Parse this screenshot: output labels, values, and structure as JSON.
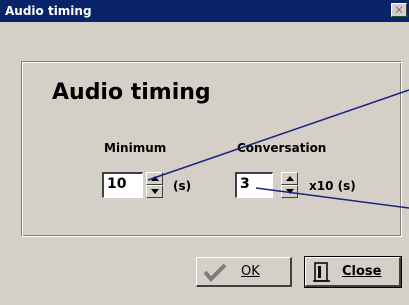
{
  "window": {
    "title": "Audio timing",
    "close_glyph": "✕"
  },
  "main": {
    "heading": "Audio timing",
    "minimum": {
      "label": "Minimum",
      "value": "10",
      "unit": "(s)"
    },
    "conversation": {
      "label": "Conversation",
      "value": "3",
      "unit": "x10 (s)"
    }
  },
  "buttons": {
    "ok_label": "OK",
    "close_label": "Close"
  },
  "colors": {
    "title_bar": "#0a246a",
    "dialog_bg": "#d4d0c8",
    "annotation_line": "#1a237e",
    "check_green": "#808080"
  }
}
